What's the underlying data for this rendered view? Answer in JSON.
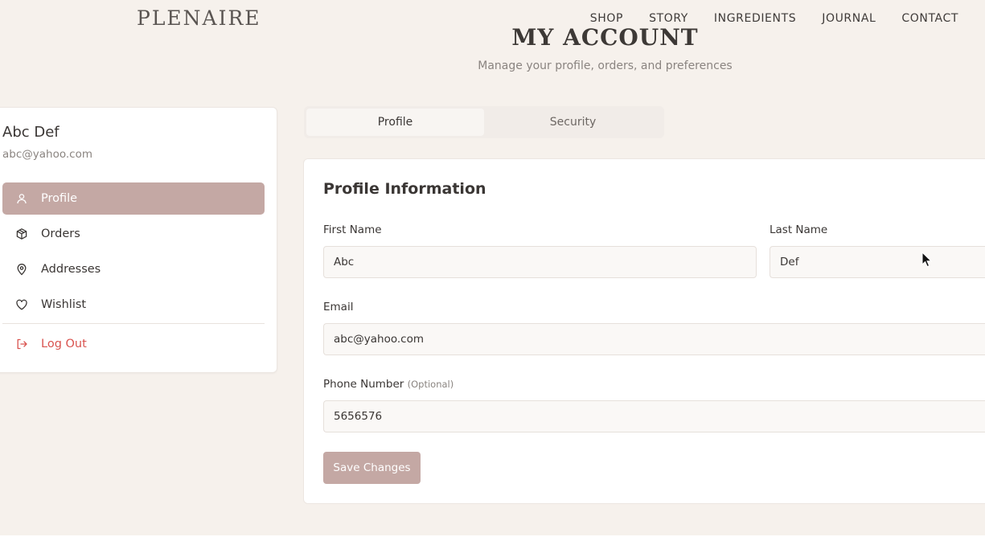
{
  "header": {
    "logo": "PLENAIRE",
    "nav": [
      "SHOP",
      "STORY",
      "INGREDIENTS",
      "JOURNAL",
      "CONTACT"
    ]
  },
  "page": {
    "title": "MY ACCOUNT",
    "subtitle": "Manage your profile, orders, and preferences"
  },
  "sidebar": {
    "user_name": "Abc Def",
    "user_email": "abc@yahoo.com",
    "items": [
      {
        "label": "Profile",
        "icon": "user-icon",
        "active": true
      },
      {
        "label": "Orders",
        "icon": "package-icon"
      },
      {
        "label": "Addresses",
        "icon": "map-pin-icon"
      },
      {
        "label": "Wishlist",
        "icon": "heart-icon"
      }
    ],
    "logout": {
      "label": "Log Out",
      "icon": "logout-icon",
      "color": "#d9534f"
    }
  },
  "tabs": [
    {
      "label": "Profile",
      "active": true
    },
    {
      "label": "Security"
    }
  ],
  "form": {
    "title": "Profile Information",
    "first_name": {
      "label": "First Name",
      "value": "Abc"
    },
    "last_name": {
      "label": "Last Name",
      "value": "Def"
    },
    "email": {
      "label": "Email",
      "value": "abc@yahoo.com"
    },
    "phone": {
      "label": "Phone Number",
      "optional": "(Optional)",
      "value": "5656576"
    },
    "save_label": "Save Changes"
  },
  "colors": {
    "accent": "#c4a8a4",
    "background": "#f6f1ec",
    "logout": "#d9534f"
  }
}
